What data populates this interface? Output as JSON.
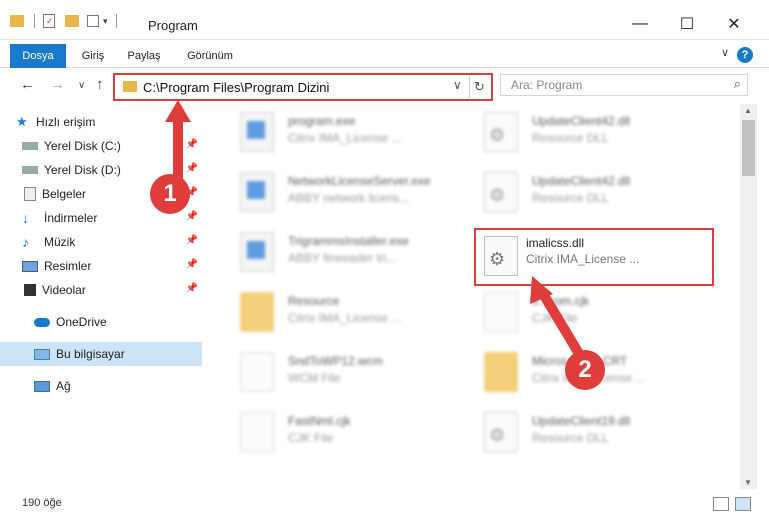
{
  "window": {
    "title": "Program",
    "minimize_glyph": "—",
    "maximize_glyph": "☐",
    "close_glyph": "✕"
  },
  "ribbon": {
    "tabs": [
      "Dosya",
      "Giriş",
      "Paylaş",
      "Görünüm"
    ],
    "help_label": "?",
    "collapse_glyph": "∨"
  },
  "address": {
    "path": "C:\\Program Files\\Program Dizini",
    "dropdown_glyph": "∨",
    "refresh_glyph": "↻"
  },
  "nav_buttons": {
    "back": "←",
    "forward": "→",
    "recent": "∨",
    "up": "↑"
  },
  "search": {
    "placeholder": "Ara: Program",
    "icon": "search-icon",
    "glyph": "⌕"
  },
  "sidebar": {
    "items": [
      {
        "label": "Hızlı erişim",
        "icon": "star-icon",
        "pinned": false
      },
      {
        "label": "Yerel Disk (C:)",
        "icon": "drive-icon",
        "pinned": true
      },
      {
        "label": "Yerel Disk (D:)",
        "icon": "drive-icon",
        "pinned": true
      },
      {
        "label": "Belgeler",
        "icon": "documents-icon",
        "pinned": true
      },
      {
        "label": "İndirmeler",
        "icon": "download-icon",
        "pinned": true
      },
      {
        "label": "Müzik",
        "icon": "music-icon",
        "pinned": true
      },
      {
        "label": "Resimler",
        "icon": "pictures-icon",
        "pinned": true
      },
      {
        "label": "Videolar",
        "icon": "video-icon",
        "pinned": true
      },
      {
        "label": "OneDrive",
        "icon": "cloud-icon",
        "pinned": false
      },
      {
        "label": "Bu bilgisayar",
        "icon": "computer-icon",
        "pinned": false
      },
      {
        "label": "Ağ",
        "icon": "network-icon",
        "pinned": false
      }
    ],
    "pin_glyph": "📌",
    "selected_label": "Bu bilgisayar"
  },
  "files": [
    {
      "name": "program.exe",
      "desc": "Citrix IMA_License ...",
      "type": "exe"
    },
    {
      "name": "UpdateClient42.dll",
      "desc": "Resource DLL",
      "type": "dll"
    },
    {
      "name": "NetworkLicenseServer.exe",
      "desc": "ABBY network licens...",
      "type": "exe"
    },
    {
      "name": "UpdateClient42.dll",
      "desc": "Resource DLL",
      "type": "dll"
    },
    {
      "name": "TrigrammsInstaller.exe",
      "desc": "ABBY fineeader tri...",
      "type": "exe"
    },
    {
      "name": "imalicss.dll",
      "desc": "Citrix IMA_License ...",
      "type": "dll"
    },
    {
      "name": "Resource",
      "desc": "Citrix IMA_License ...",
      "type": "folder"
    },
    {
      "name": "ff...com.cjk",
      "desc": "CJK File",
      "type": "doc"
    },
    {
      "name": "SndToWP12.wcm",
      "desc": "WCM File",
      "type": "doc"
    },
    {
      "name": "Micros...C90.CRT",
      "desc": "Citrix IMA_License ...",
      "type": "folder"
    },
    {
      "name": "FastNml.cjk",
      "desc": "CJK File",
      "type": "doc"
    },
    {
      "name": "UpdateClient19.dll",
      "desc": "Resource DLL",
      "type": "dll"
    }
  ],
  "highlighted_file": "imalicss.dll",
  "callouts": [
    "1",
    "2"
  ],
  "status": {
    "item_count": "190 öğe"
  },
  "colors": {
    "accent": "#1979ca",
    "highlight": "#e03c3c",
    "selected": "#cce4f7"
  }
}
